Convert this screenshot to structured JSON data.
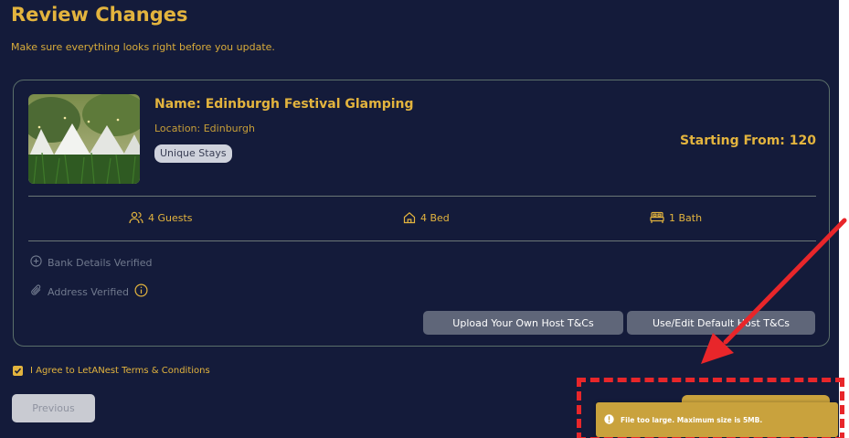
{
  "page": {
    "title": "Review Changes",
    "subtitle": "Make sure everything looks right before you update."
  },
  "listing": {
    "name": "Name: Edinburgh Festival Glamping",
    "location": "Location: Edinburgh",
    "category": "Unique Stays",
    "starting_from": "Starting From: 120",
    "stats": {
      "guests": "4 Guests",
      "beds": "4 Bed",
      "baths": "1 Bath"
    },
    "verifications": {
      "bank": "Bank Details Verified",
      "address": "Address Verified"
    },
    "buttons": {
      "upload_tcs": "Upload Your Own Host T&Cs",
      "default_tcs": "Use/Edit Default Host T&Cs"
    }
  },
  "agreement": {
    "label": "I Agree to LetANest Terms & Conditions",
    "checked": true
  },
  "navigation": {
    "previous_label": "Previous"
  },
  "toast": {
    "message": "File too large. Maximum size is 5MB."
  },
  "colors": {
    "background": "#141b3a",
    "accent": "#e3b43e",
    "toast": "#c9a23d",
    "annotation": "#e8262a"
  }
}
